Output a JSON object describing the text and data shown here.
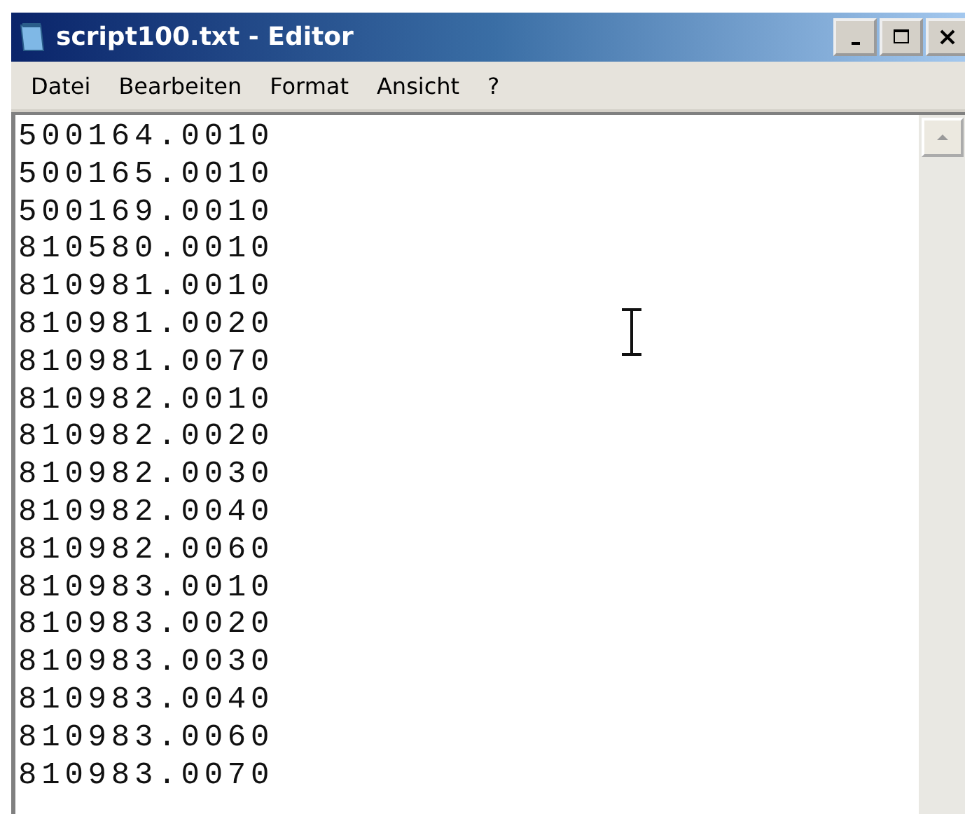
{
  "window": {
    "title": "script100.txt - Editor"
  },
  "menu": [
    "Datei",
    "Bearbeiten",
    "Format",
    "Ansicht",
    "?"
  ],
  "lines": [
    "500164.0010",
    "500165.0010",
    "500169.0010",
    "810580.0010",
    "810981.0010",
    "810981.0020",
    "810981.0070",
    "810982.0010",
    "810982.0020",
    "810982.0030",
    "810982.0040",
    "810982.0060",
    "810983.0010",
    "810983.0020",
    "810983.0030",
    "810983.0040",
    "810983.0060",
    "810983.0070"
  ]
}
